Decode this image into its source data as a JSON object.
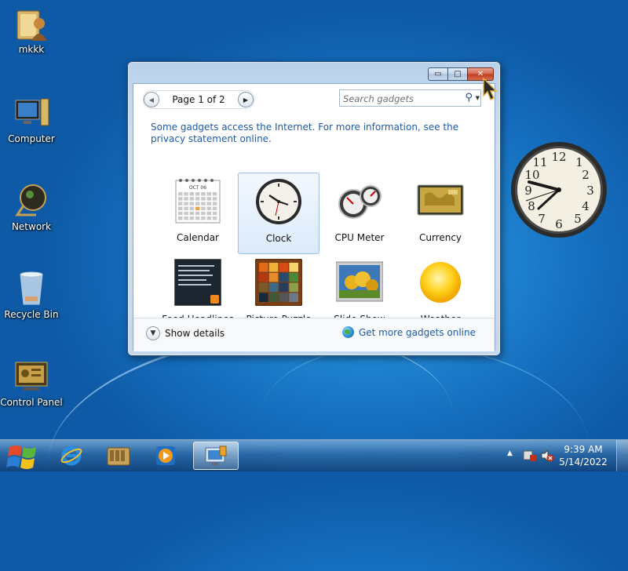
{
  "desktop": {
    "icons": [
      {
        "label": "mkkk",
        "icon": "user-folder-icon"
      },
      {
        "label": "Computer",
        "icon": "computer-icon"
      },
      {
        "label": "Network",
        "icon": "network-icon"
      },
      {
        "label": "Recycle Bin",
        "icon": "recycle-bin-icon"
      },
      {
        "label": "Control Panel",
        "icon": "control-panel-icon"
      }
    ]
  },
  "gallery": {
    "pager_label": "Page 1 of 2",
    "search_placeholder": "Search gadgets",
    "notice": "Some gadgets access the Internet.  For more information, see the privacy statement online.",
    "gadgets": [
      {
        "label": "Calendar",
        "icon": "calendar-icon",
        "selected": false
      },
      {
        "label": "Clock",
        "icon": "clock-icon",
        "selected": true
      },
      {
        "label": "CPU Meter",
        "icon": "cpu-meter-icon",
        "selected": false
      },
      {
        "label": "Currency",
        "icon": "currency-icon",
        "selected": false
      },
      {
        "label": "Feed Headlines",
        "icon": "feed-headlines-icon",
        "selected": false
      },
      {
        "label": "Picture Puzzle",
        "icon": "picture-puzzle-icon",
        "selected": false
      },
      {
        "label": "Slide Show",
        "icon": "slide-show-icon",
        "selected": false
      },
      {
        "label": "Weather",
        "icon": "weather-icon",
        "selected": false
      }
    ],
    "calendar_month": "OCT 06",
    "show_details_label": "Show details",
    "get_more_label": "Get more gadgets online"
  },
  "taskbar": {
    "time": "9:39 AM",
    "date": "5/14/2022",
    "buttons": [
      {
        "name": "internet-explorer",
        "icon": "internet-explorer-icon"
      },
      {
        "name": "file-explorer",
        "icon": "libraries-icon"
      },
      {
        "name": "media-player",
        "icon": "media-player-icon"
      },
      {
        "name": "gadgets",
        "icon": "gadgets-icon",
        "active": true
      }
    ]
  },
  "colors": {
    "link": "#1e5aa8",
    "close_button": "#c03b1e",
    "desktop": "#146cbc"
  }
}
